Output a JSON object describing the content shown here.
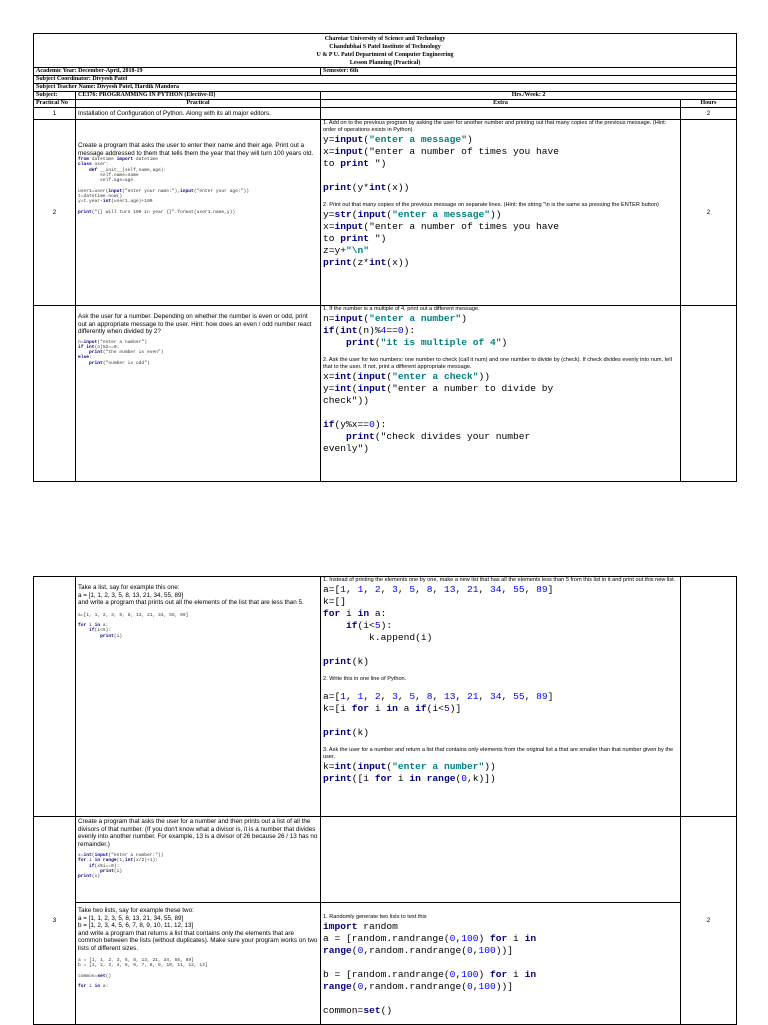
{
  "header": {
    "line1": "Charotar University of Science and Technology",
    "line2": "Chandubhai S Patel Institute of Technology",
    "line3": "U & P U. Patel Department of Computer Engineering",
    "line4": "Lesson Planning (Practical)"
  },
  "meta": {
    "academic_year": "Academic Year: December-April, 2018-19",
    "semester": "Semester: 6th",
    "coordinator": "Subject Coordinator: Divyesh Patel",
    "teachers": "Subject Teacher Name: Divyesh Patel, Hardik Mandora",
    "subject_label": "Subject:",
    "subject_name": "CE376: PROGRAMMING IN PYTHON (Elective-II)",
    "hrs_week": "Hrs./Week: 2"
  },
  "columns": {
    "practical_no": "Practical No",
    "practical": "Practical",
    "extra": "Extra",
    "hours": "Hours"
  },
  "rows": {
    "r1": {
      "no": "1",
      "practical": "Installation of Configuration of Python. Along with its all major editors.",
      "hours": "2"
    },
    "r2": {
      "no": "2",
      "hours": "2",
      "practical_text": "Create a program that asks the user to enter their name and their age. Print out a message addressed to them that tells them the year that they will turn 100 years old.",
      "practical_code": [
        "from datetime import datetime",
        "class user:",
        "    def __init__(self,name,age):",
        "        self.name=name",
        "        self.age=age",
        "",
        "user1=user(input(\"enter your name:\"),input(\"enter your age:\"))",
        "t=datetime.now()",
        "y=t.year-int(user1.age)+100",
        "",
        "print(\"{} will turn 100 in year {}\".format(user1.name,y))"
      ],
      "extra_1_text": "1. Add on to the previous program by asking the user for another number and printing out that many copies of the previous message. (Hint: order of operations exists in Python)",
      "extra_1_code": [
        "y=input(\"enter a message\")",
        "x=input(\"enter a number of times you have",
        "to print \")",
        "",
        "print(y*int(x))"
      ],
      "extra_2_text": "2. Print out that many copies of the previous message on separate lines. (Hint: the string \"\\n is the same as pressing the ENTER button)",
      "extra_2_code": [
        "y=str(input(\"enter a message\"))",
        "x=input(\"enter a number of times you have",
        "to print \")",
        "z=y+\"\\n\"",
        "print(z*int(x))"
      ]
    },
    "r2b": {
      "practical_text": "Ask the user for a number. Depending on whether the number is even or odd, print out an appropriate message to the user. Hint: how does an even / odd number react differently when divided by 2?",
      "practical_code": [
        "n=input(\"enter a number\")",
        "if int(n)%2==0:",
        "    print(\"the number is even\")",
        "else:",
        "    print(\"number is odd\")"
      ],
      "extra_1_text": "1. If the number is a multiple of 4, print out a different message.",
      "extra_1_code": [
        "n=input(\"enter a number\")",
        "if(int(n)%4==0):",
        "    print(\"it is multiple of 4\")"
      ],
      "extra_2_text": "2. Ask the user for two numbers: one number to check (call it num) and one number to divide by (check). If check divides evenly into num, tell that to the user. If not, print a different appropriate message.",
      "extra_2_code": [
        "x=int(input(\"enter a check\"))",
        "y=int(input(\"enter a number to divide by",
        "check\"))",
        "",
        "if(y%x==0):",
        "    print(\"check divides your number",
        "evenly\")"
      ]
    },
    "r3a": {
      "practical_text": "Take a list, say for example this one:\na = [1, 1, 2, 3, 5, 8, 13, 21, 34, 55, 89]\nand write a program that prints out all the elements of the list that are less than 5.",
      "practical_code": [
        "a=[1, 1, 2, 3, 5, 8, 13, 21, 34, 55, 89]",
        "",
        "for i in a:",
        "    if(i<5):",
        "        print(i)"
      ],
      "extra_1_text": "1. Instead of printing the elements one by one, make a new list that has all the elements less than 5 from this list in it and print out this new list.",
      "extra_1_code": [
        "a=[1, 1, 2, 3, 5, 8, 13, 21, 34, 55, 89]",
        "k=[]",
        "for i in a:",
        "    if(i<5):",
        "        k.append(i)",
        "",
        "print(k)"
      ],
      "extra_2_text": "2. Write this in one line of Python.",
      "extra_2_code": [
        "a=[1, 1, 2, 3, 5, 8, 13, 21, 34, 55, 89]",
        "k=[i for i in a if(i<5)]",
        "",
        "print(k)"
      ],
      "extra_3_text": "3. Ask the user for a number and return a list that contains only elements from the original list a that are smaller than that number given by the user.",
      "extra_3_code": [
        "k=int(input(\"enter a number\"))",
        "print([i for i in range(0,k)])"
      ]
    },
    "r3b": {
      "no": "3",
      "hours": "2",
      "practical_text": "Create a program that asks the user for a number and then prints out a list of all the divisors of that number. (If you don't know what a divisor is, it is a number that divides evenly into another number. For example, 13 is a divisor of 26 because 26 / 13 has no remainder.)",
      "practical_code": [
        "x=int(input(\"enter a number:\"))",
        "for i in range(1,int(x/2)+1):",
        "    if(x%i==0):",
        "        print(i)",
        "print(x)"
      ]
    },
    "r3c": {
      "practical_text": "Take two lists, say for example these two:\n a = [1, 1, 2, 3, 5, 8, 13, 21, 34, 55, 89]\n b = [1, 2, 3, 4, 5, 6, 7, 8, 9, 10, 11, 12, 13]\nand write a program that returns a list that contains only the elements that are common between the lists (without duplicates). Make sure your program works on two lists of different sizes.",
      "practical_code": [
        "a = [1, 1, 2, 3, 5, 8, 13, 21, 34, 55, 89]",
        "b = [1, 2, 3, 4, 5, 6, 7, 8, 9, 10, 11, 12, 13]",
        "",
        "common=set()",
        "",
        "for i in a:"
      ],
      "extra_1_text": "1. Randomly generate two lists to test this",
      "extra_1_code": [
        "import random",
        "a = [random.randrange(0,100) for i in",
        "range(0,random.randrange(0,100))]",
        "",
        "b = [random.randrange(0,100) for i in",
        "range(0,random.randrange(0,100))]",
        "",
        "common=set()"
      ]
    }
  }
}
